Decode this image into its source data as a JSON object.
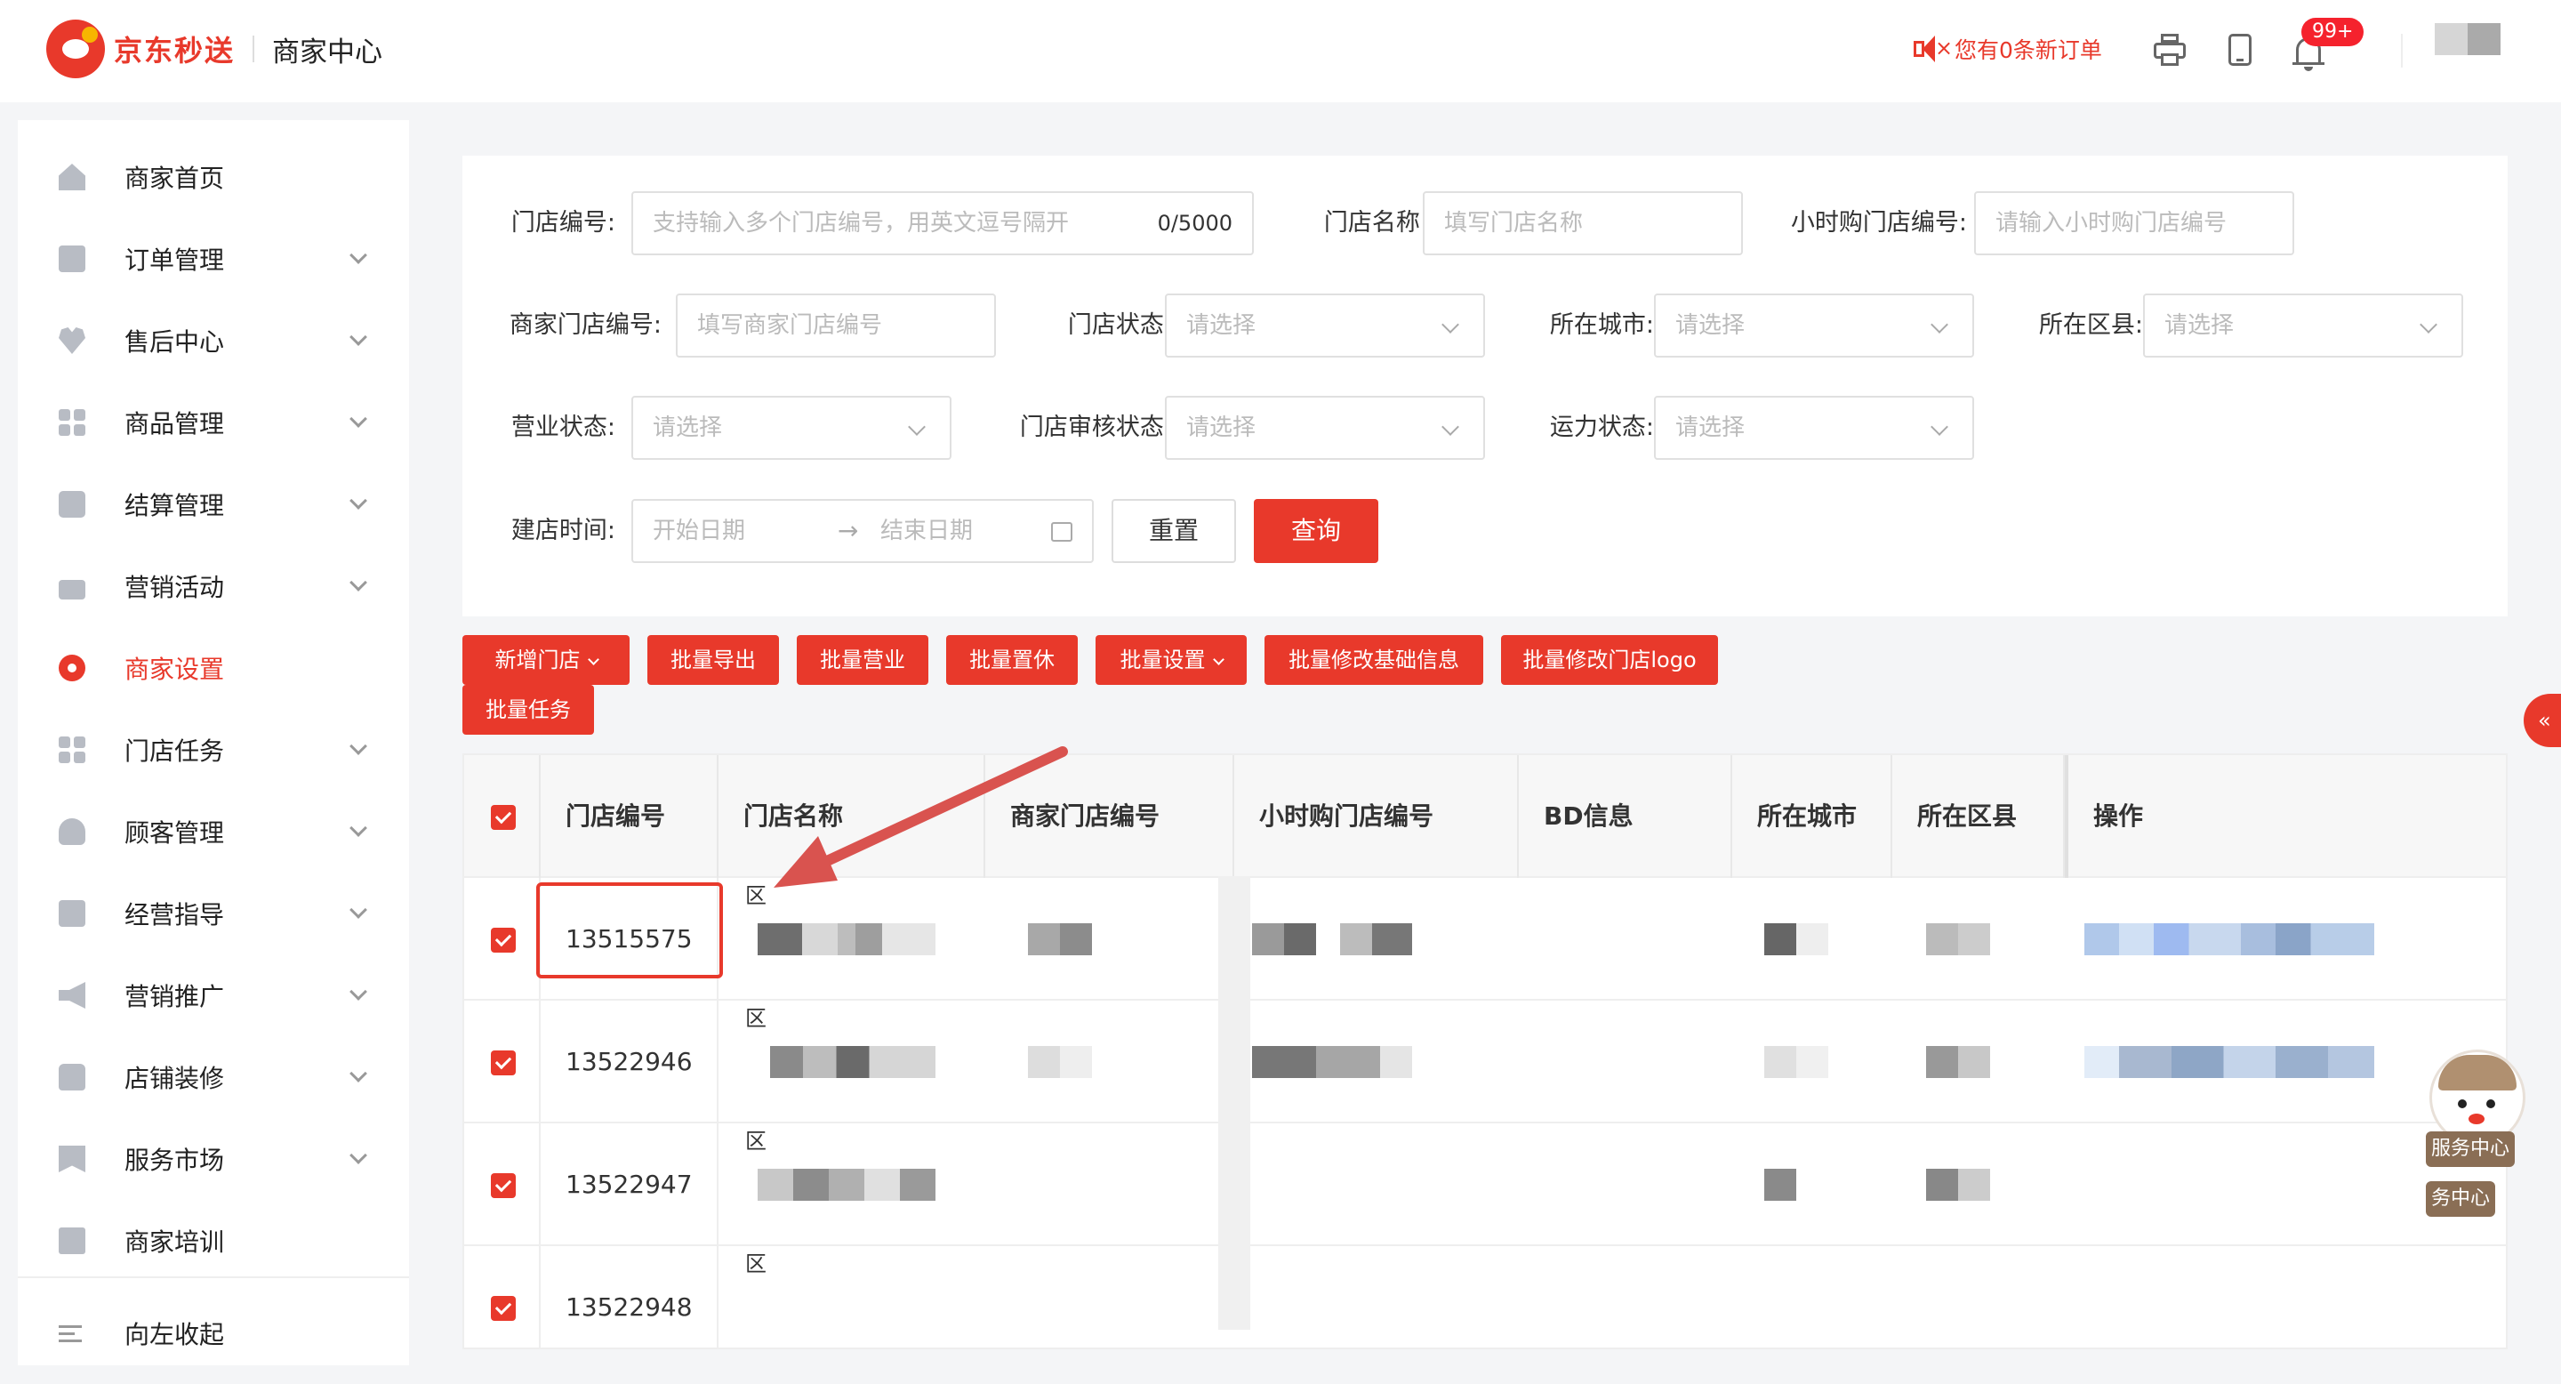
{
  "header": {
    "brand": "京东秒送",
    "subtitle": "商家中心",
    "order_notice": "您有0条新订单",
    "badge": "99+",
    "icons": [
      "mute-icon",
      "printer-icon",
      "tablet-icon",
      "bell-icon",
      "avatar"
    ]
  },
  "sidebar": {
    "items": [
      {
        "label": "商家首页",
        "icon": "home-icon",
        "expandable": false
      },
      {
        "label": "订单管理",
        "icon": "order-icon",
        "expandable": true
      },
      {
        "label": "售后中心",
        "icon": "aftersale-icon",
        "expandable": true
      },
      {
        "label": "商品管理",
        "icon": "product-icon",
        "expandable": true
      },
      {
        "label": "结算管理",
        "icon": "settlement-icon",
        "expandable": true
      },
      {
        "label": "营销活动",
        "icon": "marketing-icon",
        "expandable": true
      },
      {
        "label": "商家设置",
        "icon": "settings-icon",
        "expandable": false,
        "active": true
      },
      {
        "label": "门店任务",
        "icon": "task-icon",
        "expandable": true
      },
      {
        "label": "顾客管理",
        "icon": "customer-icon",
        "expandable": true
      },
      {
        "label": "经营指导",
        "icon": "guide-icon",
        "expandable": true
      },
      {
        "label": "营销推广",
        "icon": "promotion-icon",
        "expandable": true
      },
      {
        "label": "店铺装修",
        "icon": "decoration-icon",
        "expandable": true
      },
      {
        "label": "服务市场",
        "icon": "market-icon",
        "expandable": true
      },
      {
        "label": "商家培训",
        "icon": "training-icon",
        "expandable": false
      }
    ],
    "collapse_label": "向左收起"
  },
  "filters": {
    "store_id": {
      "label": "门店编号:",
      "placeholder": "支持输入多个门店编号，用英文逗号隔开",
      "count": "0/5000"
    },
    "store_name": {
      "label": "门店名称:",
      "placeholder": "填写门店名称"
    },
    "hourly_store_id": {
      "label": "小时购门店编号:",
      "placeholder": "请输入小时购门店编号"
    },
    "merchant_store_id": {
      "label": "商家门店编号:",
      "placeholder": "填写商家门店编号"
    },
    "store_status": {
      "label": "门店状态:",
      "placeholder": "请选择"
    },
    "city": {
      "label": "所在城市:",
      "placeholder": "请选择"
    },
    "district": {
      "label": "所在区县:",
      "placeholder": "请选择"
    },
    "business_status": {
      "label": "营业状态:",
      "placeholder": "请选择"
    },
    "review_status": {
      "label": "门店审核状态:",
      "placeholder": "请选择"
    },
    "capacity_status": {
      "label": "运力状态:",
      "placeholder": "请选择"
    },
    "created_time": {
      "label": "建店时间:",
      "start": "开始日期",
      "end": "结束日期"
    },
    "reset_label": "重置",
    "query_label": "查询"
  },
  "actions": [
    {
      "label": "新增门店",
      "dropdown": true
    },
    {
      "label": "批量导出",
      "dropdown": false
    },
    {
      "label": "批量营业",
      "dropdown": false
    },
    {
      "label": "批量置休",
      "dropdown": false
    },
    {
      "label": "批量设置",
      "dropdown": true
    },
    {
      "label": "批量修改基础信息",
      "dropdown": false
    },
    {
      "label": "批量修改门店logo",
      "dropdown": false
    },
    {
      "label": "批量任务",
      "dropdown": false
    }
  ],
  "table": {
    "columns": [
      "门店编号",
      "门店名称",
      "商家门店编号",
      "小时购门店编号",
      "BD信息",
      "所在城市",
      "所在区县",
      "操作"
    ],
    "rows": [
      {
        "id": "13515575",
        "name_prefix": "区",
        "checked": true
      },
      {
        "id": "13522946",
        "name_prefix": "区",
        "checked": true
      },
      {
        "id": "13522947",
        "name_prefix": "区",
        "checked": true
      },
      {
        "id": "13522948",
        "name_prefix": "区",
        "checked": true
      }
    ]
  },
  "floating": {
    "collapse_glyph": "«",
    "service_label": "服务中心",
    "service_label_2": "务中心"
  },
  "colors": {
    "brand_red": "#e8392b",
    "annotation_red": "#d9534f"
  }
}
